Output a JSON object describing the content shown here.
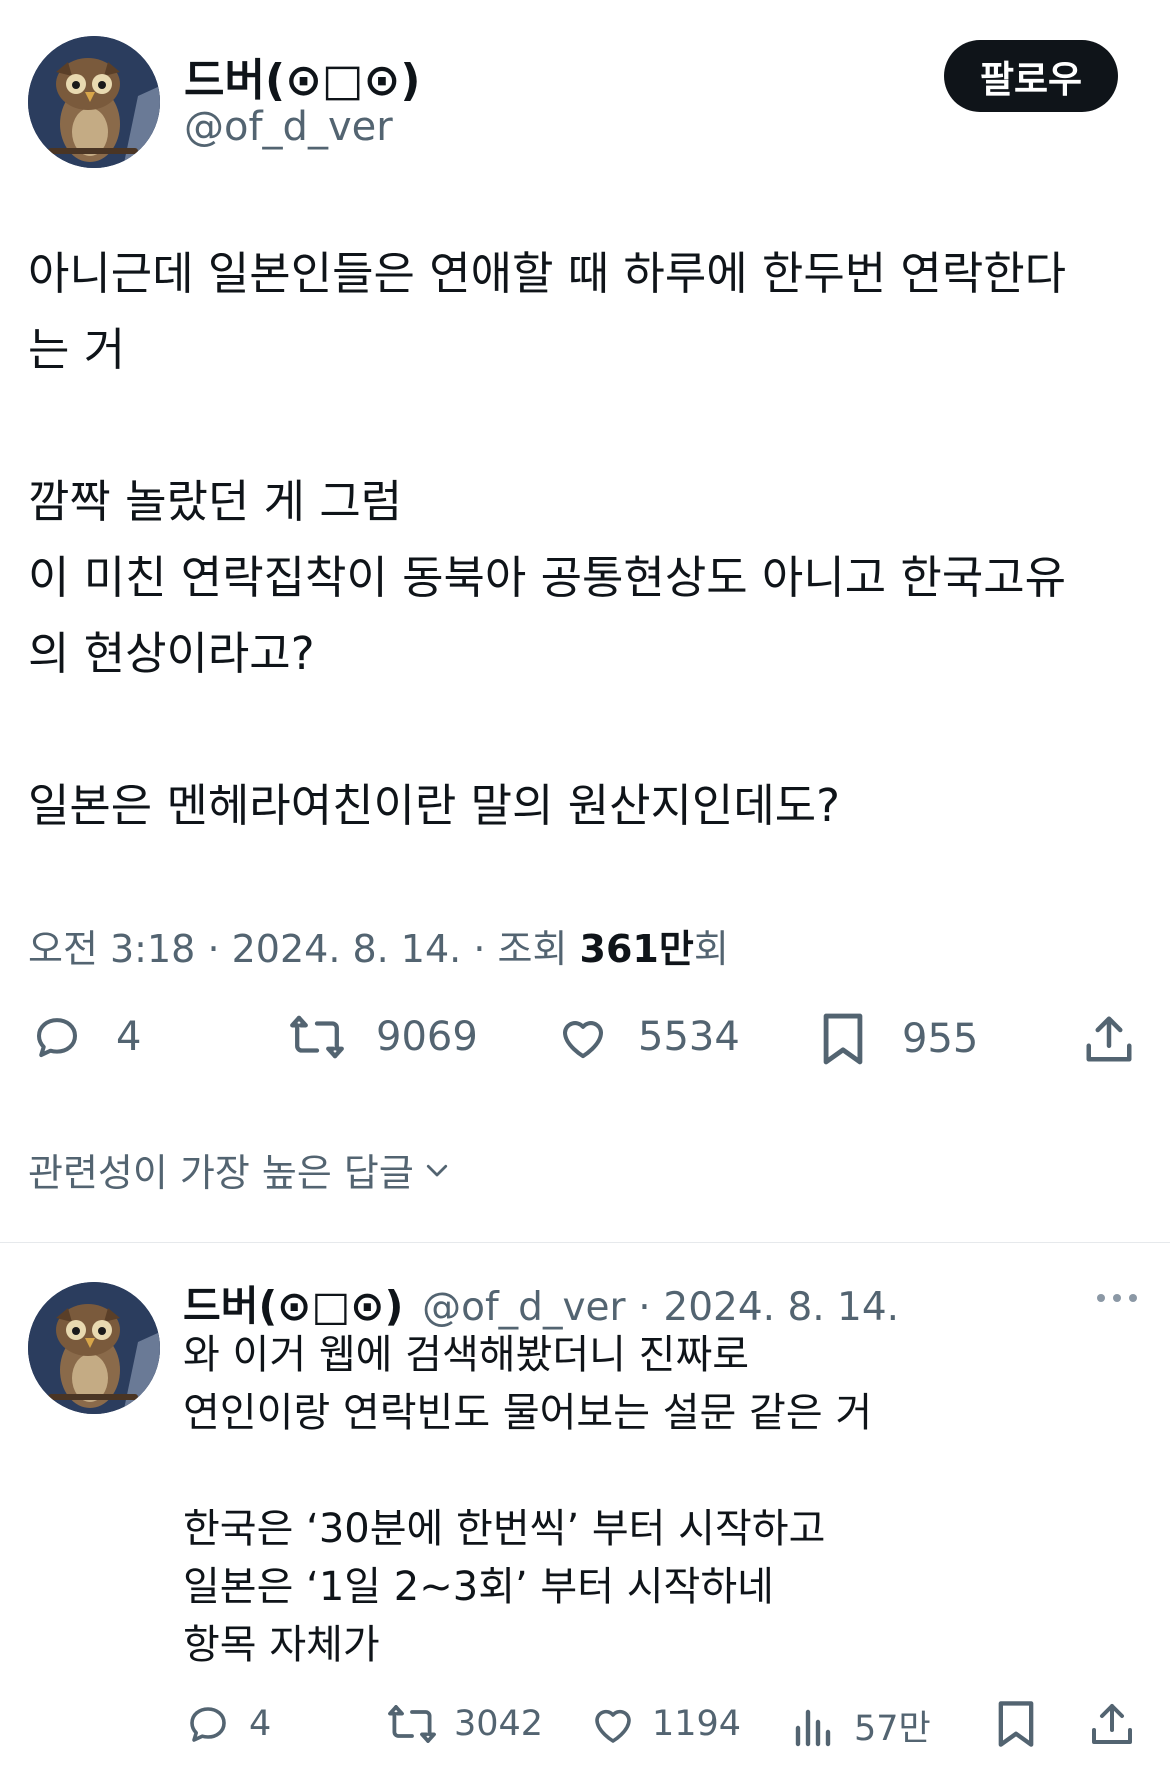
{
  "tweet": {
    "author_name": "드버(⊙□⊙)",
    "author_handle": "@of_d_ver",
    "follow_label": "팔로우",
    "text_lines": [
      "아니근데 일본인들은 연애할 때 하루에 한두번 연락한다",
      "는 거",
      "",
      "깜짝 놀랐던 게 그럼",
      "이 미친 연락집착이 동북아 공통현상도 아니고 한국고유",
      "의 현상이라고?",
      "",
      "일본은 멘헤라여친이란 말의 원산지인데도?"
    ],
    "time": "오전 3:18",
    "date": "2024. 8. 14.",
    "views_label": "조회",
    "views_number": "361",
    "views_unit": "만",
    "views_suffix": "회",
    "replies": "4",
    "retweets": "9069",
    "likes": "5534",
    "bookmarks": "955"
  },
  "sort": {
    "label": "관련성이 가장 높은 답글"
  },
  "reply": {
    "author_name": "드버(⊙□⊙)",
    "author_handle": "@of_d_ver",
    "date_sep": "·",
    "date": "2024. 8. 14.",
    "text_lines": [
      "와 이거 웹에 검색해봤더니 진짜로",
      "연인이랑 연락빈도 물어보는 설문 같은 거",
      "",
      "한국은 ‘30분에 한번씩’ 부터 시작하고",
      "일본은 ‘1일 2~3회’ 부터 시작하네",
      "항목 자체가"
    ],
    "replies": "4",
    "retweets": "3042",
    "likes": "1194",
    "views": "57만"
  },
  "icons": {
    "reply": "speech-bubble-icon",
    "retweet": "retweet-icon",
    "like": "heart-icon",
    "bookmark": "bookmark-icon",
    "share": "share-icon",
    "views": "bar-chart-icon",
    "more": "more-dots-icon",
    "chevron": "chevron-down-icon"
  },
  "colors": {
    "text": "#0f1419",
    "secondary": "#536471",
    "follow_bg": "#0f1419",
    "divider": "#e6e9ec"
  }
}
